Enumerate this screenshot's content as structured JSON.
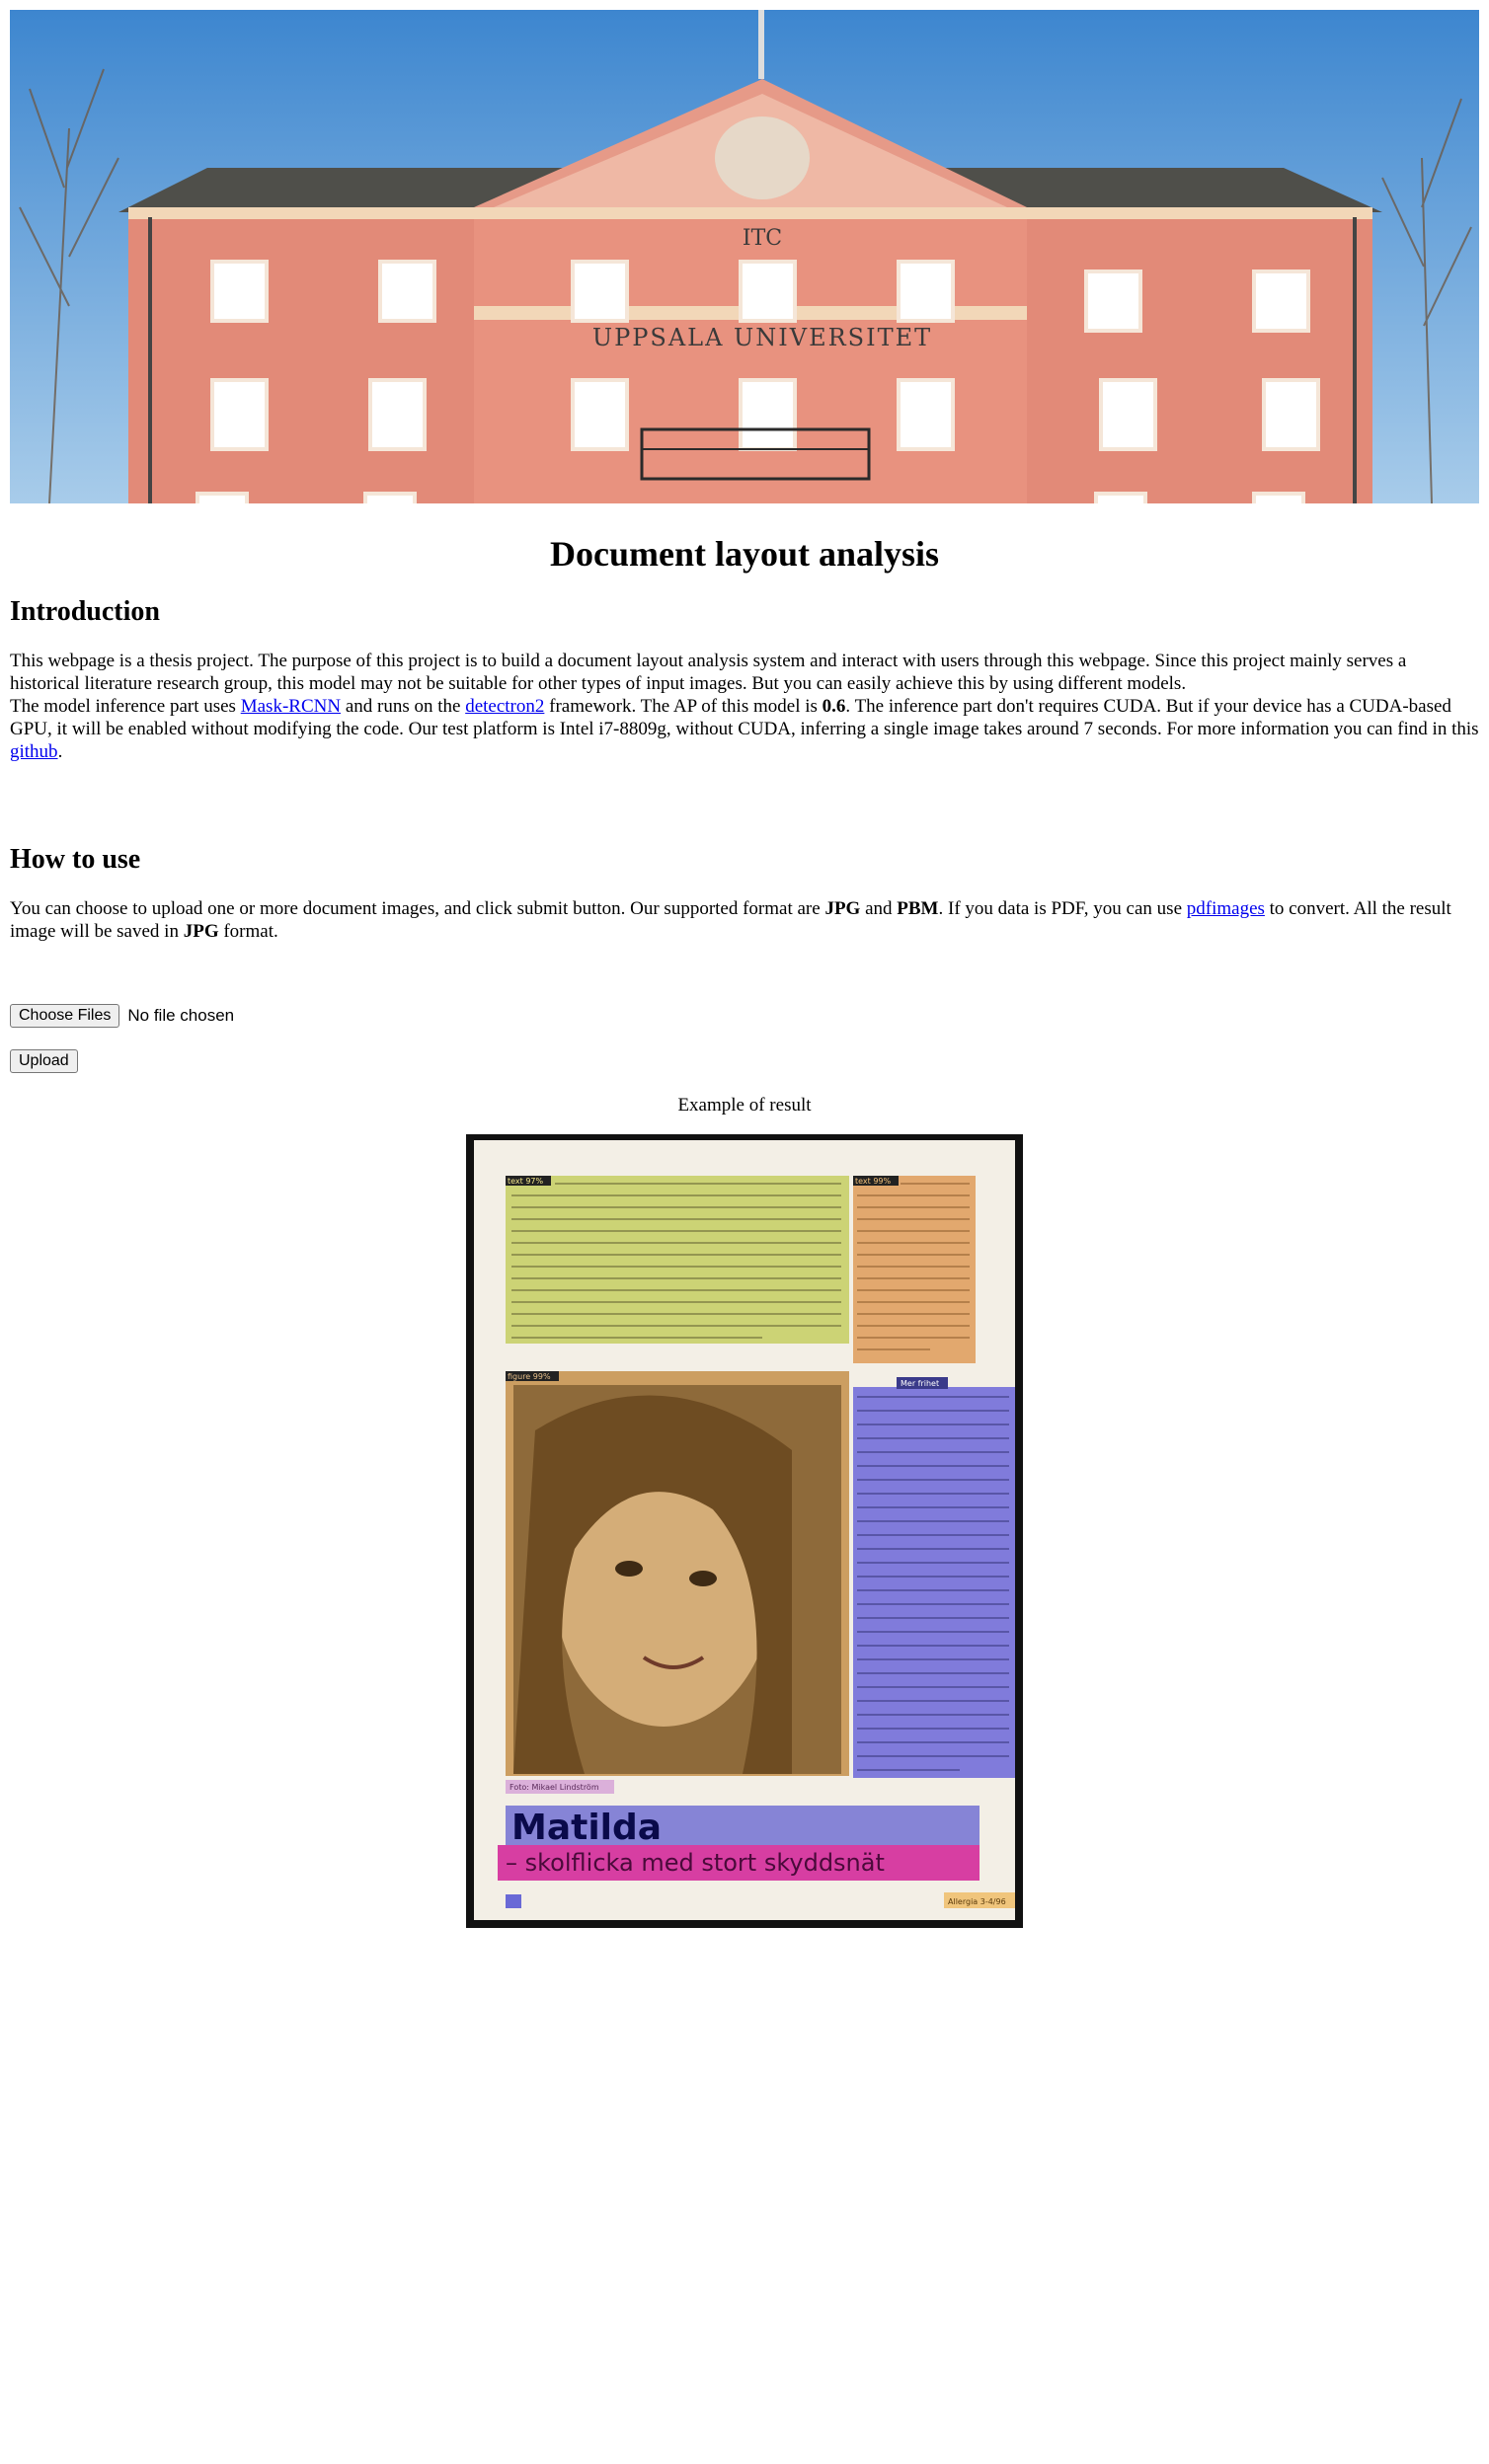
{
  "banner": {
    "building_label_1": "ITC",
    "building_label_2": "UPPSALA UNIVERSITET"
  },
  "page_title": "Document layout analysis",
  "intro": {
    "heading": "Introduction",
    "p1": "This webpage is a thesis project. The purpose of this project is to build a document layout analysis system and interact with users through this webpage. Since this project mainly serves a historical literature research group, this model may not be suitable for other types of input images. But you can easily achieve this by using different models.",
    "p2_a": "The model inference part uses ",
    "link_maskrcnn": "Mask-RCNN",
    "p2_b": " and runs on the ",
    "link_detectron": "detectron2",
    "p2_c": " framework. The AP of this model is ",
    "ap_value": "0.6",
    "p2_d": ". The inference part don't requires CUDA. But if your device has a CUDA-based GPU, it will be enabled without modifying the code. Our test platform is Intel i7-8809g, without CUDA, inferring a single image takes around 7 seconds. For more information you can find in this ",
    "link_github": "github",
    "p2_e": "."
  },
  "howto": {
    "heading": "How to use",
    "p_a": "You can choose to upload one or more document images, and click submit button. Our supported format are ",
    "fmt1": "JPG",
    "p_b": " and ",
    "fmt2": "PBM",
    "p_c": ". If you data is PDF, you can use ",
    "link_pdfimages": "pdfimages",
    "p_d": " to convert. All the result image will be saved in ",
    "fmt3": "JPG",
    "p_e": " format."
  },
  "upload": {
    "choose_label": "Choose Files",
    "no_file": "No file chosen",
    "upload_label": "Upload"
  },
  "result": {
    "caption": "Example of result",
    "labels": {
      "text1": "text 97%",
      "text2": "text 99%",
      "figure": "figure 99%",
      "title": "Matilda",
      "subtitle": "– skolflicka med stort skyddsnät",
      "photo_credit": "Foto: Mikael Lindström",
      "header_tag": "Mer frihet",
      "footer": "Allergia 3-4/96"
    }
  }
}
